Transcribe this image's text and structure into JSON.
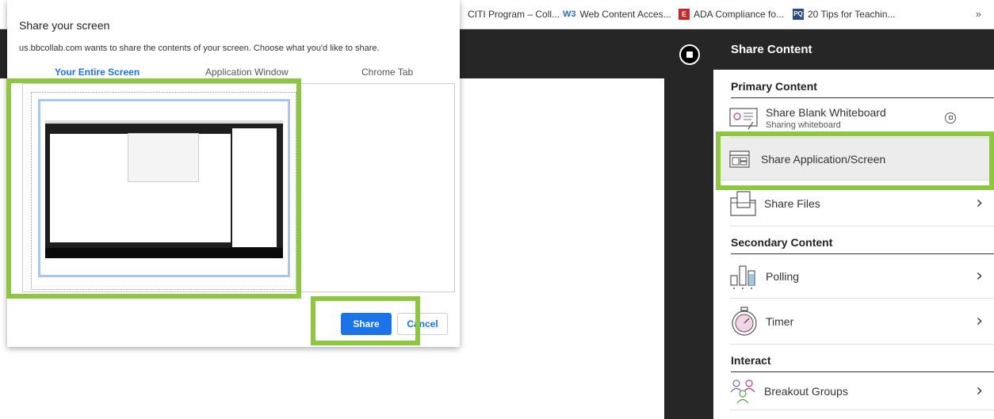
{
  "bookmarks": {
    "items": [
      {
        "label": "CITI Program – Coll...",
        "icon": "citi-icon"
      },
      {
        "label": "Web Content Acces...",
        "icon": "w3-icon",
        "badge": "W3"
      },
      {
        "label": "ADA Compliance fo...",
        "icon": "e-icon",
        "badge": "E"
      },
      {
        "label": "20 Tips for Teachin...",
        "icon": "tips-icon",
        "badge": "PQ"
      }
    ],
    "more": "»"
  },
  "dialog": {
    "title": "Share your screen",
    "description": "us.bbcollab.com wants to share the contents of your screen. Choose what you'd like to share.",
    "tabs": [
      "Your Entire Screen",
      "Application Window",
      "Chrome Tab"
    ],
    "share_label": "Share",
    "cancel_label": "Cancel"
  },
  "panel": {
    "title": "Share Content",
    "primary_title": "Primary Content",
    "whiteboard_label": "Share Blank Whiteboard",
    "whiteboard_sub": "Sharing whiteboard",
    "app_screen_label": "Share Application/Screen",
    "files_label": "Share Files",
    "secondary_title": "Secondary Content",
    "polling_label": "Polling",
    "timer_label": "Timer",
    "interact_title": "Interact",
    "breakout_label": "Breakout Groups",
    "chevron": "›"
  },
  "colors": {
    "highlight": "#8dc63f",
    "accent": "#1a73e8",
    "dark": "#262626"
  }
}
